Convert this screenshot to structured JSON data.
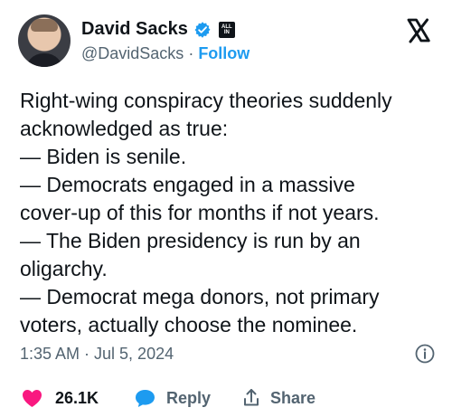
{
  "tweet": {
    "author": {
      "display_name": "David Sacks",
      "handle": "@DavidSacks",
      "separator": " · ",
      "follow_label": "Follow",
      "badge_text_top": "ALL",
      "badge_text_bottom": "IN"
    },
    "lines": [
      "Right-wing conspiracy theories suddenly",
      "acknowledged as true:",
      "— Biden is senile.",
      "— Democrats engaged in a massive",
      "cover-up of this for months if not years.",
      "— The Biden presidency is run by an",
      "oligarchy.",
      "— Democrat mega donors, not primary",
      "voters, actually choose the nominee."
    ],
    "timestamp": "1:35 AM · Jul 5, 2024"
  },
  "actions": {
    "like_count": "26.1K",
    "reply_label": "Reply",
    "share_label": "Share"
  },
  "colors": {
    "text": "#0f1419",
    "muted": "#536471",
    "accent": "#1d9bf0",
    "like": "#f91880"
  },
  "icons": {
    "verified": "verified-badge-icon",
    "brand": "x-logo-icon",
    "info": "info-icon",
    "like": "heart-icon",
    "reply": "reply-bubble-icon",
    "share": "share-icon"
  }
}
